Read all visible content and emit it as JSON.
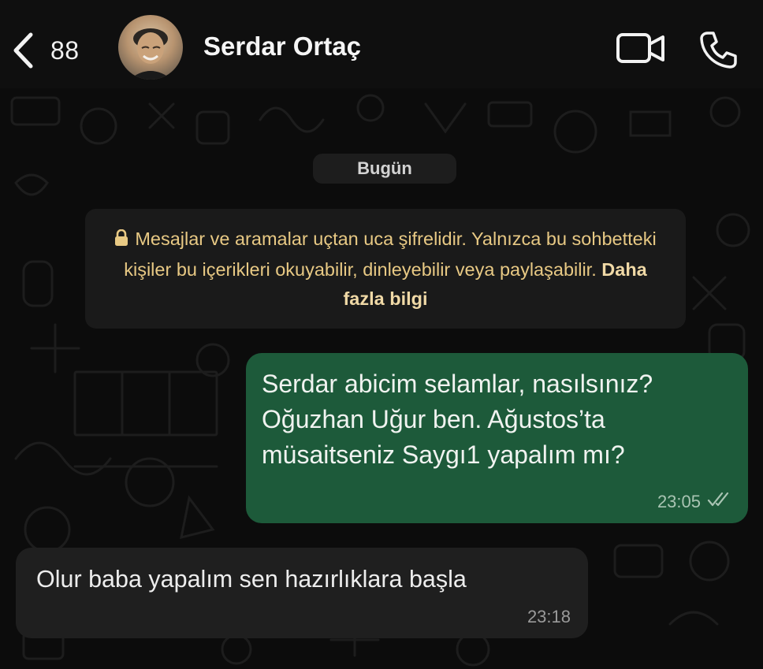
{
  "header": {
    "back_count": "88",
    "contact_name": "Serdar Ortaç",
    "icons": {
      "back": "chevron-left-icon",
      "video": "video-camera-icon",
      "call": "phone-icon"
    }
  },
  "chat": {
    "date_chip": "Bugün",
    "encryption_notice": {
      "icon": "lock-icon",
      "text": "Mesajlar ve aramalar uçtan uca şifrelidir. Yalnızca bu sohbetteki kişiler bu içerikleri okuyabilir, dinleyebilir veya paylaşabilir.",
      "link": "Daha fazla bilgi"
    },
    "messages": [
      {
        "direction": "outgoing",
        "text": "Serdar abicim selamlar, nasılsınız?\nOğuzhan Uğur ben. Ağustos’ta\nmüsaitseniz Saygı1 yapalım mı?",
        "time": "23:05",
        "status_icon": "double-check-icon"
      },
      {
        "direction": "incoming",
        "text": "Olur baba yapalım sen hazırlıklara başla",
        "time": "23:18"
      }
    ]
  },
  "colors": {
    "outgoing_bubble": "#1d5a3a",
    "incoming_bubble": "#1f1f1f",
    "notice_text": "#e8c984",
    "background": "#0c0c0c"
  }
}
